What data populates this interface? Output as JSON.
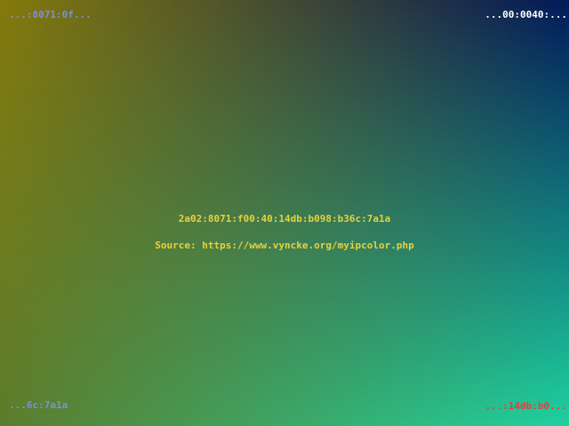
{
  "colors": {
    "top_left": "#847a0c",
    "top_right": "#021a5a",
    "bottom_left": "#5c7c2c",
    "bottom_right": "#1ed2a0",
    "center_text": "#e6d23c",
    "top_left_label": "#7f8fd8",
    "top_right_label": "#ffffff",
    "bottom_left_label": "#7f8fd8",
    "bottom_right_label": "#f03a3a"
  },
  "corners": {
    "top_left": "...:8071:0f...",
    "top_right": "...00:0040:...",
    "bottom_left": "...6c:7a1a",
    "bottom_right": "...:14db:b0..."
  },
  "center": {
    "ip_address": "2a02:8071:f00:40:14db:b098:b36c:7a1a",
    "source": "Source: https://www.vyncke.org/myipcolor.php"
  }
}
